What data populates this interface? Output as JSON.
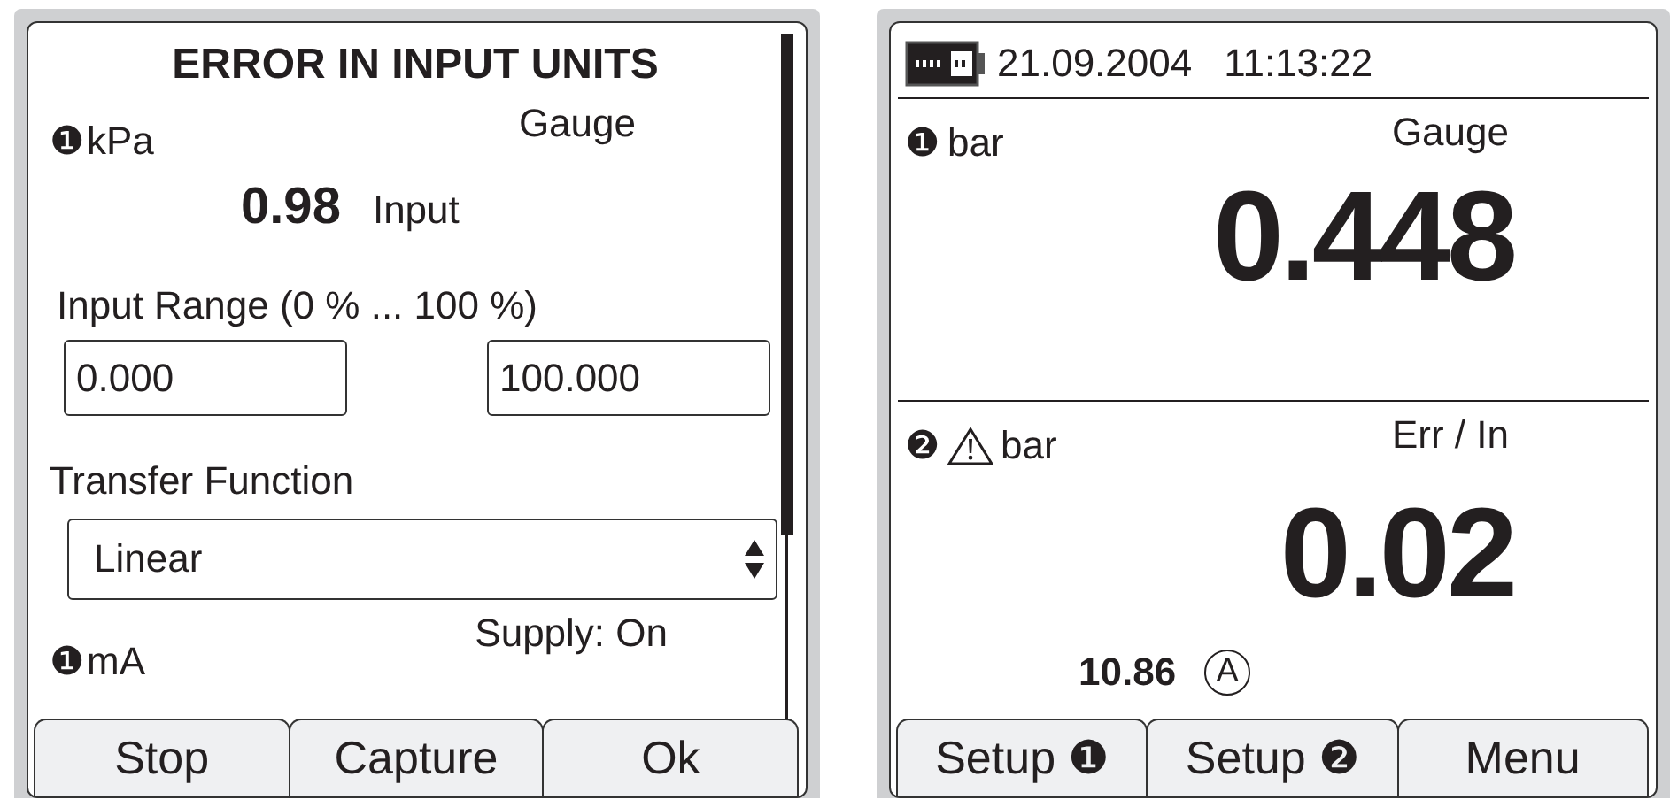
{
  "config_screen": {
    "title": "ERROR IN INPUT UNITS",
    "primary": {
      "badge": "❶",
      "unit": "kPa",
      "mode": "Gauge",
      "reading": "0.98",
      "reading_label": "Input"
    },
    "range": {
      "label": "Input Range (0 % ... 100 %)",
      "low": "0.000",
      "high": "100.000"
    },
    "transfer": {
      "label": "Transfer Function",
      "value": "Linear"
    },
    "secondary": {
      "badge": "❶",
      "unit": "mA",
      "supply": "Supply: On"
    },
    "softkeys": [
      "Stop",
      "Capture",
      "Ok"
    ]
  },
  "meter_screen": {
    "date": "21.09.2004",
    "time": "11:13:22",
    "channels": [
      {
        "badge": "❶",
        "warning": false,
        "unit": "bar",
        "mode": "Gauge",
        "reading": "0.448"
      },
      {
        "badge": "❷",
        "warning": true,
        "unit": "bar",
        "mode": "Err / In",
        "reading": "0.02",
        "sub_reading": "10.86",
        "sub_marker": "A"
      }
    ],
    "softkeys": [
      "Setup ❶",
      "Setup ❷",
      "Menu"
    ]
  }
}
